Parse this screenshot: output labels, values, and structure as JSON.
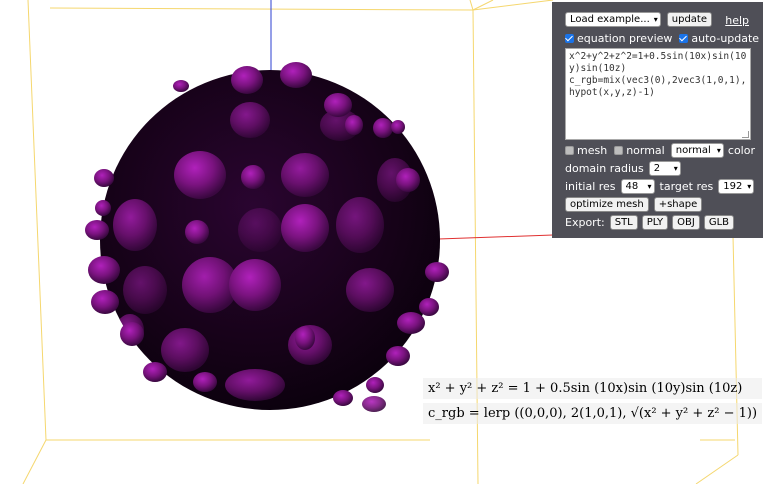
{
  "panel": {
    "load_example_label": "Load example...",
    "update_label": "update",
    "help_label": "help",
    "equation_preview_label": "equation preview",
    "equation_preview_checked": true,
    "auto_update_label": "auto-update",
    "auto_update_checked": true,
    "equation_text": "x^2+y^2+z^2=1+0.5sin(10x)sin(10y)sin(10z)\nc_rgb=mix(vec3(0),2vec3(1,0,1),hypot(x,y,z)-1)",
    "mesh_label": "mesh",
    "mesh_checked": false,
    "normal_label": "normal",
    "normal_checked": false,
    "color_mode_value": "normal",
    "color_label": "color",
    "domain_radius_label": "domain radius",
    "domain_radius_value": "2",
    "initial_res_label": "initial res",
    "initial_res_value": "48",
    "target_res_label": "target res",
    "target_res_value": "192",
    "optimize_mesh_label": "optimize mesh",
    "add_shape_label": "+shape",
    "export_label": "Export:",
    "export_buttons": [
      "STL",
      "PLY",
      "OBJ",
      "GLB"
    ]
  },
  "formula": {
    "line1": "x² + y² + z² = 1 + 0.5sin (10x)sin (10y)sin (10z)",
    "line2": "c_rgb = lerp ((0,0,0), 2(1,0,1), √(x² + y² + z² − 1))"
  },
  "colors": {
    "surface_dark": "#1a0320",
    "surface_bright": "#a01aa8",
    "bounding_box": "#f5d76e",
    "panel_bg": "#4f4f57",
    "axis_red": "#e03030",
    "axis_blue": "#2b3fd0"
  }
}
